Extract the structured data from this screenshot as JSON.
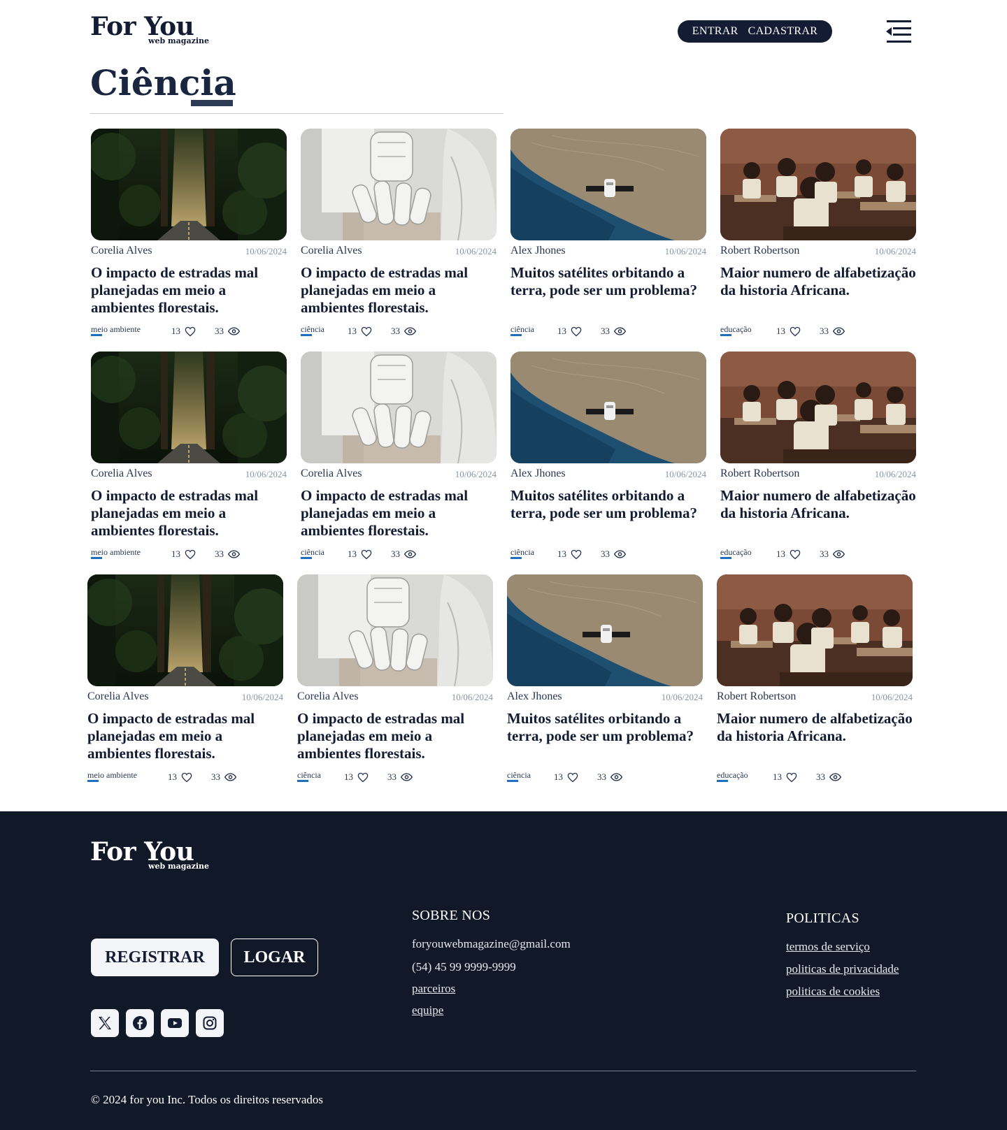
{
  "header": {
    "logo_main": "For You",
    "logo_sub": "web magazine",
    "login_label": "ENTRAR",
    "signup_label": "CADASTRAR"
  },
  "section": {
    "title": "Ciência"
  },
  "cards": [
    {
      "image": "forest-road",
      "author": "Corelia Alves",
      "date": "10/06/2024",
      "title": "O impacto de estradas mal planejadas em meio a ambientes florestais.",
      "tag": "meio ambiente",
      "likes": "13",
      "views": "33"
    },
    {
      "image": "robot-hand",
      "author": "Corelia Alves",
      "date": "10/06/2024",
      "title": "O impacto de estradas mal planejadas em meio a ambientes florestais.",
      "tag": "ciência",
      "likes": "13",
      "views": "33"
    },
    {
      "image": "satellite-earth",
      "author": "Alex Jhones",
      "date": "10/06/2024",
      "title": "Muitos satélites orbitando a terra, pode ser um problema?",
      "tag": "ciência",
      "likes": "13",
      "views": "33"
    },
    {
      "image": "classroom",
      "author": "Robert Robertson",
      "date": "10/06/2024",
      "title": "Maior numero de alfabetização da historia Africana.",
      "tag": "educação",
      "likes": "13",
      "views": "33"
    },
    {
      "image": "forest-road",
      "author": "Corelia Alves",
      "date": "10/06/2024",
      "title": "O impacto de estradas mal planejadas em meio a ambientes florestais.",
      "tag": "meio ambiente",
      "likes": "13",
      "views": "33"
    },
    {
      "image": "robot-hand",
      "author": "Corelia Alves",
      "date": "10/06/2024",
      "title": "O impacto de estradas mal planejadas em meio a ambientes florestais.",
      "tag": "ciência",
      "likes": "13",
      "views": "33"
    },
    {
      "image": "satellite-earth",
      "author": "Alex Jhones",
      "date": "10/06/2024",
      "title": "Muitos satélites orbitando a terra, pode ser um problema?",
      "tag": "ciência",
      "likes": "13",
      "views": "33"
    },
    {
      "image": "classroom",
      "author": "Robert Robertson",
      "date": "10/06/2024",
      "title": "Maior numero de alfabetização da historia Africana.",
      "tag": "educação",
      "likes": "13",
      "views": "33"
    },
    {
      "image": "forest-road",
      "author": "Corelia Alves",
      "date": "10/06/2024",
      "title": "O impacto de estradas mal planejadas em meio a ambientes florestais.",
      "tag": "meio ambiente",
      "likes": "13",
      "views": "33"
    },
    {
      "image": "robot-hand",
      "author": "Corelia Alves",
      "date": "10/06/2024",
      "title": "O impacto de estradas mal planejadas em meio a ambientes florestais.",
      "tag": "ciência",
      "likes": "13",
      "views": "33"
    },
    {
      "image": "satellite-earth",
      "author": "Alex Jhones",
      "date": "10/06/2024",
      "title": "Muitos satélites orbitando a terra, pode ser um problema?",
      "tag": "ciência",
      "likes": "13",
      "views": "33"
    },
    {
      "image": "classroom",
      "author": "Robert Robertson",
      "date": "10/06/2024",
      "title": "Maior numero de alfabetização da historia Africana.",
      "tag": "educação",
      "likes": "13",
      "views": "33"
    }
  ],
  "footer": {
    "logo_main": "For You",
    "logo_sub": "web magazine",
    "register_label": "REGISTRAR",
    "login_label": "LOGAR",
    "social": [
      "x-icon",
      "facebook-icon",
      "youtube-icon",
      "instagram-icon"
    ],
    "about": {
      "title": "SOBRE NOS",
      "email": "foryouwebmagazine@gmail.com",
      "phone": "(54) 45  99 9999-9999",
      "partners": "parceiros",
      "team": "equipe"
    },
    "policies": {
      "title": "POLITICAS",
      "terms": "termos de serviço",
      "privacy": "politicas de privacidade",
      "cookies": "politicas de cookies"
    },
    "copyright": "© 2024 for you Inc. Todos os direitos reservados"
  },
  "colors": {
    "navy": "#141c33",
    "footer_bg": "#111827",
    "tag_accent": "#1f6fbf",
    "muted": "#8a93a6"
  }
}
